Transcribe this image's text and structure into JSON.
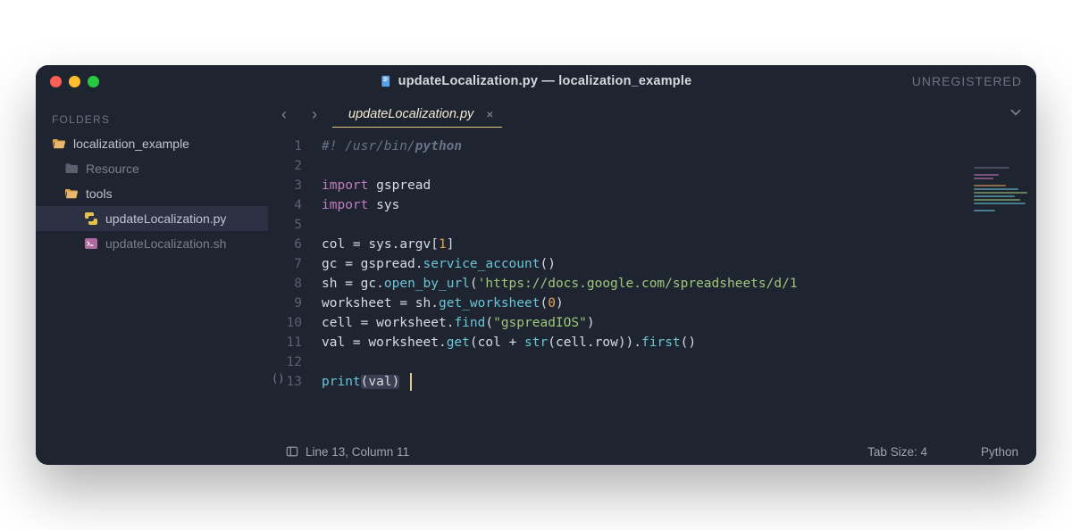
{
  "titlebar": {
    "title": "updateLocalization.py — localization_example",
    "unregistered": "UNREGISTERED"
  },
  "sidebar": {
    "heading": "FOLDERS",
    "root": "localization_example",
    "items": [
      {
        "label": "Resource",
        "icon": "folder",
        "dim": true
      },
      {
        "label": "tools",
        "icon": "folder-open",
        "dim": false
      }
    ],
    "files": [
      {
        "label": "updateLocalization.py",
        "icon": "py",
        "active": true
      },
      {
        "label": "updateLocalization.sh",
        "icon": "sh",
        "active": false
      }
    ]
  },
  "tabs": {
    "current": "updateLocalization.py"
  },
  "code": {
    "lines": [
      {
        "n": 1,
        "tokens": [
          {
            "t": "#! /usr/bin/",
            "c": "cm"
          },
          {
            "t": "python",
            "c": "cm-b"
          }
        ]
      },
      {
        "n": 2,
        "tokens": []
      },
      {
        "n": 3,
        "tokens": [
          {
            "t": "import",
            "c": "kw"
          },
          {
            "t": " gspread",
            "c": "nm"
          }
        ]
      },
      {
        "n": 4,
        "tokens": [
          {
            "t": "import",
            "c": "kw"
          },
          {
            "t": " sys",
            "c": "nm"
          }
        ]
      },
      {
        "n": 5,
        "tokens": []
      },
      {
        "n": 6,
        "tokens": [
          {
            "t": "col ",
            "c": "nm"
          },
          {
            "t": "=",
            "c": "op"
          },
          {
            "t": " sys",
            "c": "nm"
          },
          {
            "t": ".",
            "c": "op"
          },
          {
            "t": "argv",
            "c": "nm"
          },
          {
            "t": "[",
            "c": "op"
          },
          {
            "t": "1",
            "c": "num"
          },
          {
            "t": "]",
            "c": "op"
          }
        ]
      },
      {
        "n": 7,
        "tokens": [
          {
            "t": "gc ",
            "c": "nm"
          },
          {
            "t": "=",
            "c": "op"
          },
          {
            "t": " gspread",
            "c": "nm"
          },
          {
            "t": ".",
            "c": "op"
          },
          {
            "t": "service_account",
            "c": "fn"
          },
          {
            "t": "()",
            "c": "op"
          }
        ]
      },
      {
        "n": 8,
        "tokens": [
          {
            "t": "sh ",
            "c": "nm"
          },
          {
            "t": "=",
            "c": "op"
          },
          {
            "t": " gc",
            "c": "nm"
          },
          {
            "t": ".",
            "c": "op"
          },
          {
            "t": "open_by_url",
            "c": "fn"
          },
          {
            "t": "(",
            "c": "op"
          },
          {
            "t": "'https://docs.google.com/spreadsheets/d/1",
            "c": "str"
          }
        ]
      },
      {
        "n": 9,
        "tokens": [
          {
            "t": "worksheet ",
            "c": "nm"
          },
          {
            "t": "=",
            "c": "op"
          },
          {
            "t": " sh",
            "c": "nm"
          },
          {
            "t": ".",
            "c": "op"
          },
          {
            "t": "get_worksheet",
            "c": "fn"
          },
          {
            "t": "(",
            "c": "op"
          },
          {
            "t": "0",
            "c": "num"
          },
          {
            "t": ")",
            "c": "op"
          }
        ]
      },
      {
        "n": 10,
        "tokens": [
          {
            "t": "cell ",
            "c": "nm"
          },
          {
            "t": "=",
            "c": "op"
          },
          {
            "t": " worksheet",
            "c": "nm"
          },
          {
            "t": ".",
            "c": "op"
          },
          {
            "t": "find",
            "c": "fn"
          },
          {
            "t": "(",
            "c": "op"
          },
          {
            "t": "\"gspreadIOS\"",
            "c": "str"
          },
          {
            "t": ")",
            "c": "op"
          }
        ]
      },
      {
        "n": 11,
        "tokens": [
          {
            "t": "val ",
            "c": "nm"
          },
          {
            "t": "=",
            "c": "op"
          },
          {
            "t": " worksheet",
            "c": "nm"
          },
          {
            "t": ".",
            "c": "op"
          },
          {
            "t": "get",
            "c": "fn"
          },
          {
            "t": "(col ",
            "c": "op"
          },
          {
            "t": "+",
            "c": "op"
          },
          {
            "t": " ",
            "c": "op"
          },
          {
            "t": "str",
            "c": "fn"
          },
          {
            "t": "(cell",
            "c": "op"
          },
          {
            "t": ".",
            "c": "op"
          },
          {
            "t": "row))",
            "c": "op"
          },
          {
            "t": ".",
            "c": "op"
          },
          {
            "t": "first",
            "c": "fn"
          },
          {
            "t": "()",
            "c": "op"
          }
        ]
      },
      {
        "n": 12,
        "tokens": []
      },
      {
        "n": 13,
        "tokens": [
          {
            "t": "print",
            "c": "fn"
          },
          {
            "t": "(val)",
            "c": "op hl"
          }
        ],
        "caret": true
      }
    ]
  },
  "statusbar": {
    "position": "Line 13, Column 11",
    "tab_size": "Tab Size: 4",
    "language": "Python"
  },
  "gutter_marker": "()"
}
